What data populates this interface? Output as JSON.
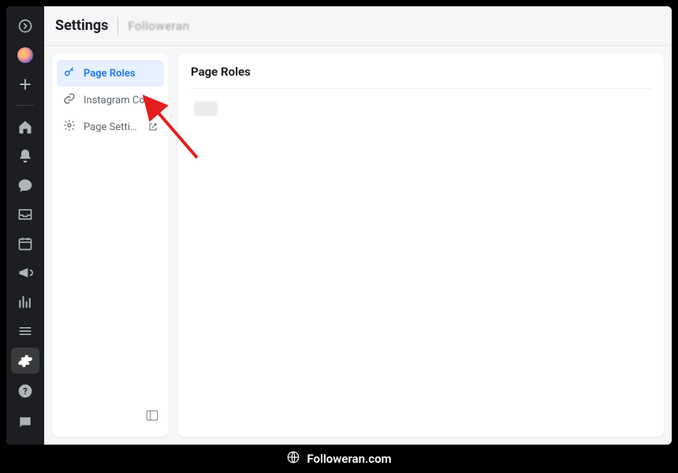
{
  "rail": {
    "items": [
      {
        "name": "expand-icon"
      },
      {
        "name": "palette-icon"
      },
      {
        "name": "plus-icon"
      },
      {
        "name": "home-icon"
      },
      {
        "name": "bell-icon"
      },
      {
        "name": "chat-icon"
      },
      {
        "name": "inbox-icon"
      },
      {
        "name": "calendar-icon"
      },
      {
        "name": "megaphone-icon"
      },
      {
        "name": "insights-icon"
      },
      {
        "name": "menu-icon"
      },
      {
        "name": "gear-icon",
        "active": true
      }
    ],
    "bottom": [
      {
        "name": "help-icon"
      },
      {
        "name": "feedback-icon"
      }
    ]
  },
  "header": {
    "title": "Settings",
    "subtitle": "Followeran"
  },
  "settings_nav": {
    "items": [
      {
        "label": "Page Roles",
        "icon": "key-icon",
        "selected": true
      },
      {
        "label": "Instagram Conn…",
        "icon": "link-icon",
        "selected": false
      },
      {
        "label": "Page Settings",
        "icon": "gear-icon",
        "selected": false,
        "external": true
      }
    ]
  },
  "content": {
    "title": "Page Roles"
  },
  "footer": {
    "text": "Followeran.com"
  },
  "colors": {
    "accent": "#1877F2"
  }
}
